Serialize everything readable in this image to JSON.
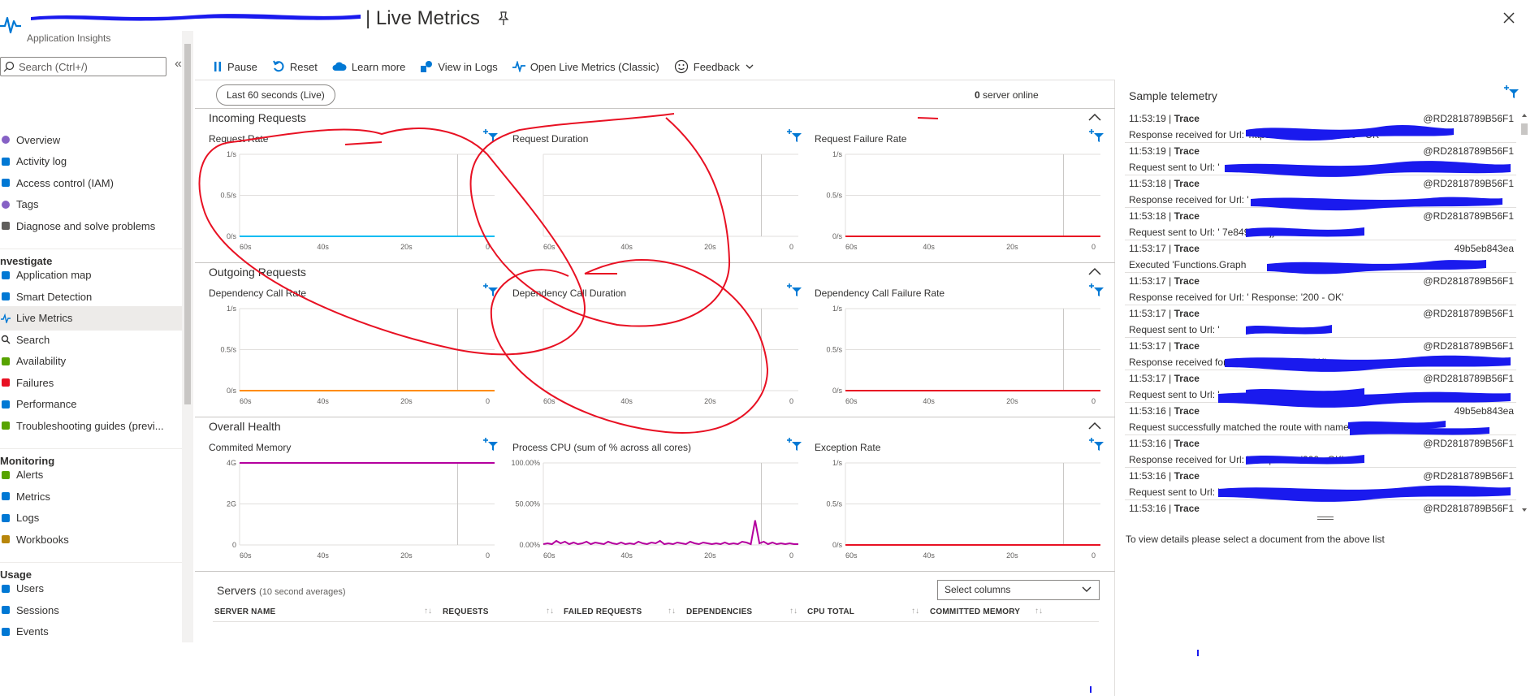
{
  "header": {
    "title": "| Live Metrics",
    "subtitle": "Application Insights"
  },
  "sidebar": {
    "search_placeholder": "Search (Ctrl+/)",
    "items_top": [
      {
        "label": "Overview",
        "icon": "overview-icon",
        "color": "#8661c5"
      },
      {
        "label": "Activity log",
        "icon": "activity-log-icon",
        "color": "#0078d4"
      },
      {
        "label": "Access control (IAM)",
        "icon": "iam-icon",
        "color": "#0078d4"
      },
      {
        "label": "Tags",
        "icon": "tag-icon",
        "color": "#8661c5"
      },
      {
        "label": "Diagnose and solve problems",
        "icon": "diagnose-icon",
        "color": "#605e5c"
      }
    ],
    "section_investigate": "nvestigate",
    "items_investigate": [
      {
        "label": "Application map",
        "icon": "app-map-icon",
        "color": "#0078d4"
      },
      {
        "label": "Smart Detection",
        "icon": "smart-detection-icon",
        "color": "#0078d4"
      },
      {
        "label": "Live Metrics",
        "icon": "live-metrics-icon",
        "color": "#0078d4"
      },
      {
        "label": "Search",
        "icon": "search-icon",
        "color": "#323130"
      },
      {
        "label": "Availability",
        "icon": "availability-icon",
        "color": "#57a300"
      },
      {
        "label": "Failures",
        "icon": "failures-icon",
        "color": "#e81123"
      },
      {
        "label": "Performance",
        "icon": "performance-icon",
        "color": "#0078d4"
      },
      {
        "label": "Troubleshooting guides (previ...",
        "icon": "troubleshooting-icon",
        "color": "#57a300"
      }
    ],
    "section_monitoring": "Monitoring",
    "items_monitoring": [
      {
        "label": "Alerts",
        "icon": "alerts-icon",
        "color": "#57a300"
      },
      {
        "label": "Metrics",
        "icon": "metrics-icon",
        "color": "#0078d4"
      },
      {
        "label": "Logs",
        "icon": "logs-icon",
        "color": "#0078d4"
      },
      {
        "label": "Workbooks",
        "icon": "workbooks-icon",
        "color": "#b8860b"
      }
    ],
    "section_usage": "Usage",
    "items_usage": [
      {
        "label": "Users",
        "icon": "users-icon",
        "color": "#0078d4"
      },
      {
        "label": "Sessions",
        "icon": "sessions-icon",
        "color": "#0078d4"
      },
      {
        "label": "Events",
        "icon": "events-icon",
        "color": "#0078d4"
      }
    ],
    "active": "Live Metrics"
  },
  "toolbar": {
    "pause": "Pause",
    "reset": "Reset",
    "learn_more": "Learn more",
    "view_in_logs": "View in Logs",
    "open_classic": "Open Live Metrics (Classic)",
    "feedback": "Feedback"
  },
  "main": {
    "time_range": "Last 60 seconds (Live)",
    "servers_online_count": "0",
    "servers_online_label": "server online"
  },
  "sections": {
    "incoming": "Incoming Requests",
    "outgoing": "Outgoing Requests",
    "health": "Overall Health"
  },
  "chart_data": [
    {
      "type": "line",
      "title": "Request Rate",
      "x": [
        "60s",
        "40s",
        "20s",
        "0"
      ],
      "yticks": [
        "1/s",
        "0.5/s",
        "0/s"
      ],
      "ylim": [
        0,
        1
      ],
      "series": [
        {
          "color": "#00bcf2",
          "values": [
            0,
            0,
            0,
            0,
            0,
            0,
            0,
            0,
            0,
            0,
            0,
            0,
            0,
            0,
            0,
            0,
            0,
            0,
            0,
            0,
            0,
            0,
            0,
            0,
            0,
            0,
            0,
            0,
            0,
            0,
            0
          ]
        }
      ]
    },
    {
      "type": "line",
      "title": "Request Duration",
      "x": [
        "60s",
        "40s",
        "20s",
        "0"
      ],
      "yticks": [],
      "series": []
    },
    {
      "type": "line",
      "title": "Request Failure Rate",
      "x": [
        "60s",
        "40s",
        "20s",
        "0"
      ],
      "yticks": [
        "1/s",
        "0.5/s",
        "0/s"
      ],
      "ylim": [
        0,
        1
      ],
      "series": [
        {
          "color": "#e81123",
          "values": [
            0,
            0,
            0,
            0,
            0,
            0,
            0,
            0,
            0,
            0,
            0,
            0,
            0,
            0,
            0,
            0,
            0,
            0,
            0,
            0,
            0,
            0,
            0,
            0,
            0,
            0,
            0,
            0,
            0,
            0,
            0
          ]
        }
      ]
    },
    {
      "type": "line",
      "title": "Dependency Call Rate",
      "x": [
        "60s",
        "40s",
        "20s",
        "0"
      ],
      "yticks": [
        "1/s",
        "0.5/s",
        "0/s"
      ],
      "ylim": [
        0,
        1
      ],
      "series": [
        {
          "color": "#ff8c00",
          "values": [
            0,
            0,
            0,
            0,
            0,
            0,
            0,
            0,
            0,
            0,
            0,
            0,
            0,
            0,
            0,
            0,
            0,
            0,
            0,
            0,
            0,
            0,
            0,
            0,
            0,
            0,
            0,
            0,
            0,
            0,
            0
          ]
        }
      ]
    },
    {
      "type": "line",
      "title": "Dependency Call Duration",
      "x": [
        "60s",
        "40s",
        "20s",
        "0"
      ],
      "yticks": [],
      "series": []
    },
    {
      "type": "line",
      "title": "Dependency Call Failure Rate",
      "x": [
        "60s",
        "40s",
        "20s",
        "0"
      ],
      "yticks": [
        "1/s",
        "0.5/s",
        "0/s"
      ],
      "ylim": [
        0,
        1
      ],
      "series": [
        {
          "color": "#e81123",
          "values": [
            0,
            0,
            0,
            0,
            0,
            0,
            0,
            0,
            0,
            0,
            0,
            0,
            0,
            0,
            0,
            0,
            0,
            0,
            0,
            0,
            0,
            0,
            0,
            0,
            0,
            0,
            0,
            0,
            0,
            0,
            0
          ]
        }
      ]
    },
    {
      "type": "line",
      "title": "Commited Memory",
      "x": [
        "60s",
        "40s",
        "20s",
        "0"
      ],
      "yticks": [
        "4G",
        "2G",
        "0"
      ],
      "ylim": [
        0,
        4
      ],
      "series": [
        {
          "color": "#b4009e",
          "values": [
            4,
            4,
            4,
            4,
            4,
            4,
            4,
            4,
            4,
            4,
            4,
            4,
            4,
            4,
            4,
            4,
            4,
            4,
            4,
            4,
            4,
            4,
            4,
            4,
            4,
            4,
            4,
            4,
            4,
            4,
            4
          ]
        }
      ]
    },
    {
      "type": "line",
      "title": "Process CPU (sum of % across all cores)",
      "x": [
        "60s",
        "40s",
        "20s",
        "0"
      ],
      "yticks": [
        "100.00%",
        "50.00%",
        "0.00%"
      ],
      "ylim": [
        0,
        100
      ],
      "series": [
        {
          "color": "#b4009e",
          "values": [
            1,
            2,
            1,
            5,
            2,
            4,
            1,
            3,
            1,
            2,
            4,
            1,
            3,
            2,
            1,
            4,
            2,
            1,
            3,
            1,
            2,
            1,
            4,
            2,
            1,
            3,
            2,
            5,
            1,
            2,
            1,
            3,
            2,
            1,
            4,
            2,
            1,
            3,
            2,
            1,
            2,
            1,
            3,
            1,
            2,
            1,
            4,
            3,
            1,
            30,
            2,
            4,
            1,
            3,
            1,
            2,
            1,
            2,
            1,
            1
          ]
        }
      ]
    },
    {
      "type": "line",
      "title": "Exception Rate",
      "x": [
        "60s",
        "40s",
        "20s",
        "0"
      ],
      "yticks": [
        "1/s",
        "0.5/s",
        "0/s"
      ],
      "ylim": [
        0,
        1
      ],
      "series": [
        {
          "color": "#e81123",
          "values": [
            0,
            0,
            0,
            0,
            0,
            0,
            0,
            0,
            0,
            0,
            0,
            0,
            0,
            0,
            0,
            0,
            0,
            0,
            0,
            0,
            0,
            0,
            0,
            0,
            0,
            0,
            0,
            0,
            0,
            0,
            0
          ]
        }
      ]
    }
  ],
  "servers": {
    "title": "Servers",
    "subtitle": "(10 second averages)",
    "select_columns": "Select columns",
    "columns": [
      "SERVER NAME",
      "REQUESTS",
      "FAILED REQUESTS",
      "DEPENDENCIES",
      "CPU TOTAL",
      "COMMITTED MEMORY"
    ]
  },
  "telemetry": {
    "title": "Sample telemetry",
    "hint": "To view details please select a document from the above list",
    "items": [
      {
        "time": "11:53:19",
        "type": "Trace",
        "server": "@RD2818789B56F1",
        "message": "Response received for Url: 'https://...               Response: '200 - OK'"
      },
      {
        "time": "11:53:19",
        "type": "Trace",
        "server": "@RD2818789B56F1",
        "message": "Request sent to Url: '"
      },
      {
        "time": "11:53:18",
        "type": "Trace",
        "server": "@RD2818789B56F1",
        "message": "Response received for Url: '"
      },
      {
        "time": "11:53:18",
        "type": "Trace",
        "server": "@RD2818789B56F1",
        "message": "Request sent to Url: '                              7e849390\"]}'"
      },
      {
        "time": "11:53:17",
        "type": "Trace",
        "server": "49b5eb843ea",
        "message": "Executed 'Functions.Graph"
      },
      {
        "time": "11:53:17",
        "type": "Trace",
        "server": "@RD2818789B56F1",
        "message": "Response received for Url: '              Response: '200 - OK'"
      },
      {
        "time": "11:53:17",
        "type": "Trace",
        "server": "@RD2818789B56F1",
        "message": "Request sent to Url: '"
      },
      {
        "time": "11:53:17",
        "type": "Trace",
        "server": "@RD2818789B56F1",
        "message": "Response received for Url: '              ponse: '200 - OK'"
      },
      {
        "time": "11:53:17",
        "type": "Trace",
        "server": "@RD2818789B56F1",
        "message": "Request sent to Url: '"
      },
      {
        "time": "11:53:16",
        "type": "Trace",
        "server": "49b5eb843ea",
        "message": "Request successfully matched the route with name '"
      },
      {
        "time": "11:53:16",
        "type": "Trace",
        "server": "@RD2818789B56F1",
        "message": "Response received for Url: '              Response: '200 - OK'"
      },
      {
        "time": "11:53:16",
        "type": "Trace",
        "server": "@RD2818789B56F1",
        "message": "Request sent to Url: '"
      },
      {
        "time": "11:53:16",
        "type": "Trace",
        "server": "@RD2818789B56F1",
        "message": ""
      }
    ]
  },
  "colors": {
    "accent": "#0078d4",
    "annotation": "#e81123",
    "redaction": "#1a1aee"
  }
}
